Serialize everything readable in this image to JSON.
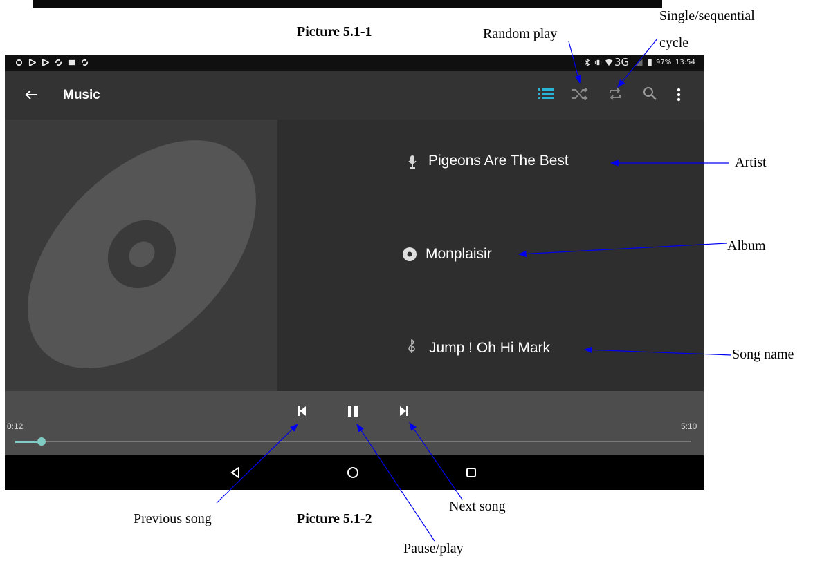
{
  "captions": {
    "top": "Picture 5.1-1",
    "bottom": "Picture 5.1-2"
  },
  "statusbar": {
    "notification_icons": [
      "circle-icon",
      "play-outline-icon",
      "play-outline-icon",
      "sync-icon",
      "image-icon",
      "sync-icon"
    ],
    "network": "3G",
    "battery": "97%",
    "time": "13:54"
  },
  "appbar": {
    "title": "Music",
    "active_color": "#29b6d6"
  },
  "track": {
    "artist": "Pigeons Are The Best",
    "album": "Monplaisir",
    "song": "Jump ! Oh Hi Mark"
  },
  "playback": {
    "elapsed": "0:12",
    "duration": "5:10",
    "progress_fraction": 0.039,
    "state": "playing",
    "accent_color": "#80cbc4"
  },
  "annotations": {
    "random_play": "Random play",
    "cycle_line1": "Single/sequential",
    "cycle_line2": "cycle",
    "artist": "Artist",
    "album": "Album",
    "song_name": "Song name",
    "previous_song": "Previous song",
    "next_song": "Next song",
    "pause_play": "Pause/play",
    "arrow_color": "#0000ee"
  }
}
